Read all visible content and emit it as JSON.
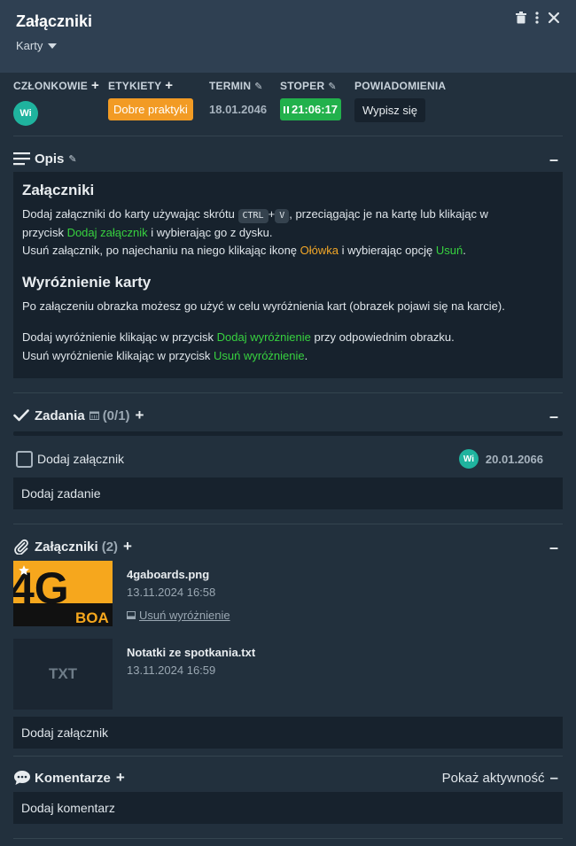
{
  "header": {
    "title": "Załączniki",
    "list_name": "Karty"
  },
  "meta": {
    "members_label": "CZŁONKOWIE",
    "member_initials": "Wi",
    "labels_label": "ETYKIETY",
    "label_chip": "Dobre praktyki",
    "due_label": "TERMIN",
    "due_value": "18.01.2046",
    "stopwatch_label": "STOPER",
    "stopwatch_value": "21:06:17",
    "notifications_label": "POWIADOMIENIA",
    "notifications_button": "Wypisz się"
  },
  "description": {
    "heading": "Opis",
    "h1": "Załączniki",
    "p1_a": "Dodaj załączniki do karty używając skrótu ",
    "kbd1": "CTRL",
    "plus": "+",
    "kbd2": "V",
    "p1_b": ", przeciągając je na kartę lub klikając w",
    "p1_c": "przycisk ",
    "p1_link": "Dodaj załącznik",
    "p1_d": " i wybierając go z dysku.",
    "p2_a": "Usuń załącznik, po najechaniu na niego klikając ikonę ",
    "p2_orange": "Ołówka",
    "p2_b": " i wybierając opcję ",
    "p2_link": "Usuń",
    "p2_c": ".",
    "h2": "Wyróżnienie karty",
    "p3": "Po załączeniu obrazka możesz go użyć w celu wyróżnienia kart (obrazek pojawi się na karcie).",
    "p4_a": "Dodaj wyróżnienie klikając w przycisk ",
    "p4_link": "Dodaj wyróżnienie",
    "p4_b": " przy odpowiednim obrazku.",
    "p5_a": "Usuń wyróżnienie klikając w przycisk ",
    "p5_link": "Usuń wyróżnienie",
    "p5_b": "."
  },
  "tasks": {
    "heading": "Zadania",
    "count": "(0/1)",
    "items": [
      {
        "label": "Dodaj załącznik",
        "assignee": "Wi",
        "due": "20.01.2066"
      }
    ],
    "add_placeholder": "Dodaj zadanie"
  },
  "attachments": {
    "heading": "Załączniki",
    "count": "(2)",
    "items": [
      {
        "name": "4gaboards.png",
        "date": "13.11.2024 16:58",
        "action": "Usuń wyróżnienie",
        "thumb_text_1": "4G",
        "thumb_text_2": "BOA"
      },
      {
        "name": "Notatki ze spotkania.txt",
        "date": "13.11.2024 16:59",
        "thumb_label": "TXT"
      }
    ],
    "add_button": "Dodaj załącznik"
  },
  "comments": {
    "heading": "Komentarze",
    "show_activity": "Pokaż aktywność",
    "add_placeholder": "Dodaj komentarz"
  }
}
